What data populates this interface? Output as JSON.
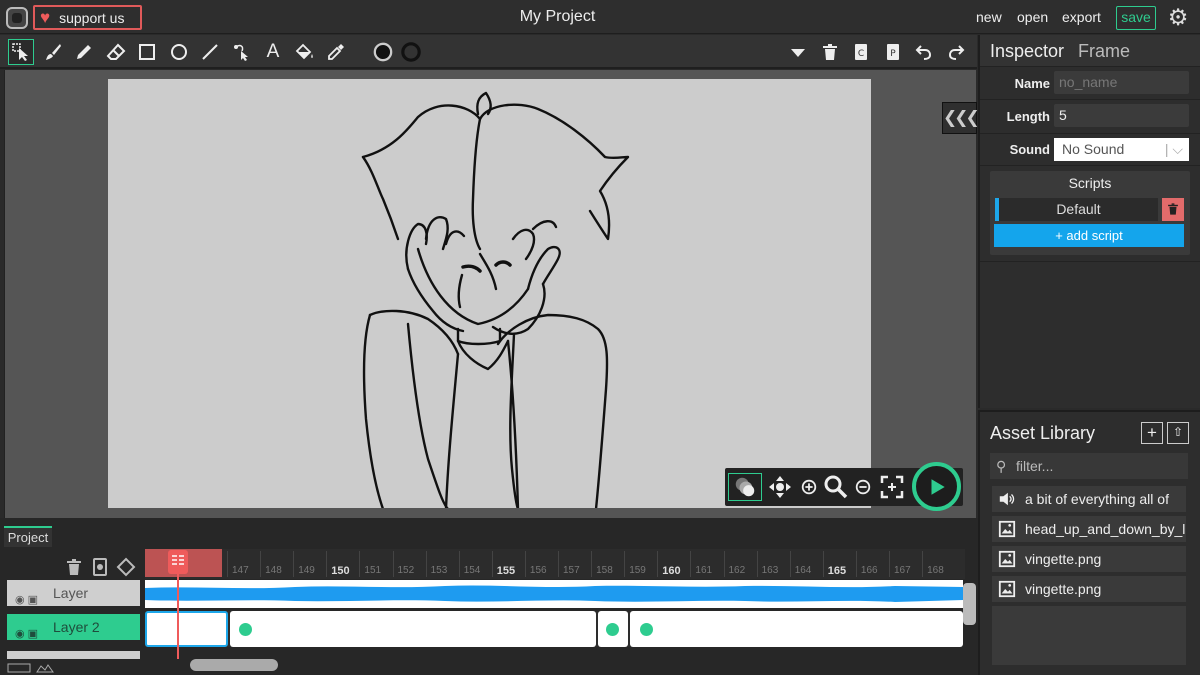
{
  "topbar": {
    "support_label": "support us",
    "title": "My Project",
    "menu": [
      "new",
      "open",
      "export"
    ],
    "save_label": "save"
  },
  "toolbar": {
    "tools": [
      "select-icon",
      "brush-icon",
      "pencil-icon",
      "eraser-icon",
      "rectangle-icon",
      "ellipse-icon",
      "line-icon",
      "path-edit-icon",
      "text-icon",
      "fill-bucket-icon",
      "eyedropper-icon",
      "fill-color-swatch",
      "stroke-color-swatch"
    ],
    "right_tools": [
      "dropdown-icon",
      "delete-icon",
      "copy-icon",
      "paste-icon",
      "undo-icon",
      "redo-icon"
    ]
  },
  "inspector": {
    "title": "Inspector",
    "subtitle": "Frame",
    "name_label": "Name",
    "name_placeholder": "no_name",
    "length_label": "Length",
    "length_value": "5",
    "sound_label": "Sound",
    "sound_value": "No Sound",
    "scripts_title": "Scripts",
    "script_default": "Default",
    "add_script_label": "+ add script"
  },
  "assets": {
    "title": "Asset Library",
    "filter_placeholder": "filter...",
    "items": [
      {
        "name": "a bit of everything all of",
        "icon": "sound-icon"
      },
      {
        "name": "head_up_and_down_by_l",
        "icon": "image-icon"
      },
      {
        "name": "vingette.png",
        "icon": "image-icon"
      },
      {
        "name": "vingette.png",
        "icon": "image-icon"
      }
    ]
  },
  "timeline": {
    "tab_label": "Project",
    "frame_numbers": [
      "147",
      "148",
      "149",
      "150",
      "151",
      "152",
      "153",
      "154",
      "155",
      "156",
      "157",
      "158",
      "159",
      "160",
      "161",
      "162",
      "163",
      "164",
      "165",
      "166",
      "167",
      "168"
    ],
    "major_frames": [
      "150",
      "155",
      "160",
      "165"
    ],
    "layers": [
      {
        "name": "Layer",
        "selected": false
      },
      {
        "name": "Layer 2",
        "selected": true
      }
    ]
  },
  "colors": {
    "accent": "#2ecc8f",
    "support_red": "#e05a5a",
    "script_blue": "#14a5ec",
    "playhead": "#ef5b5b"
  }
}
